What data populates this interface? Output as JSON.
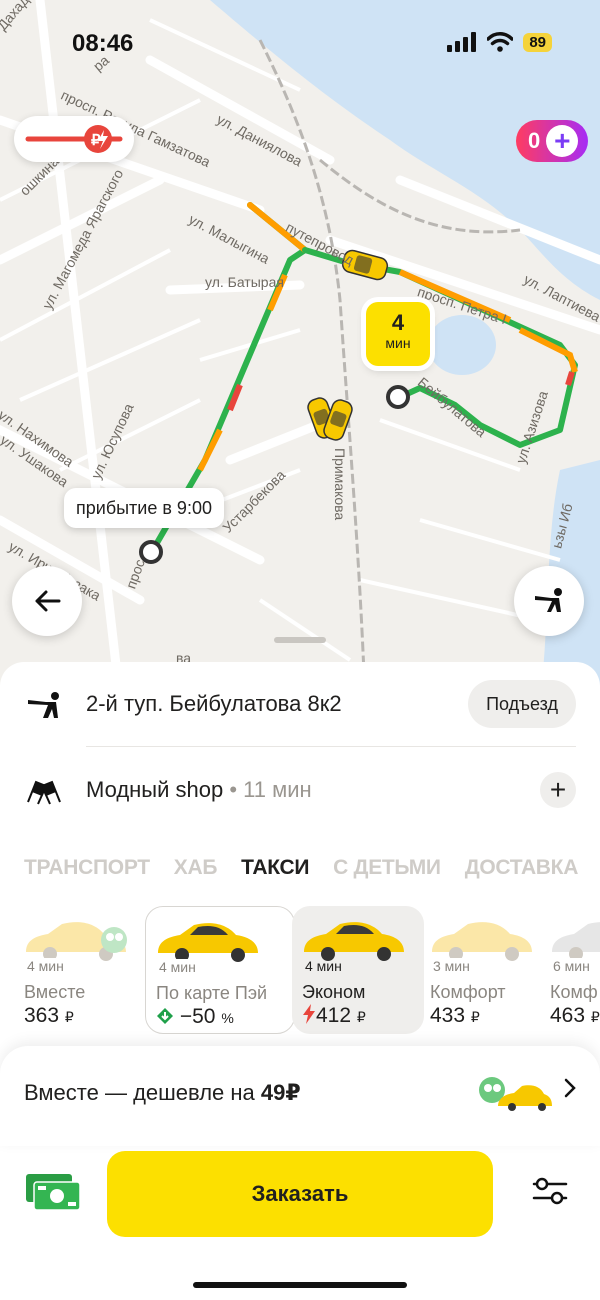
{
  "status_bar": {
    "time": "08:46",
    "battery": "89"
  },
  "map": {
    "streets": [
      "Дахадаев",
      "ра",
      "просп. Расула Гамзатова",
      "ул. Даниялова",
      "ошкина",
      "ул. Магомеда Ярагского",
      "ул. Малыгина",
      "путепровод",
      "ул. Батырая",
      "ул. Лаптиева",
      "просп. Петра I",
      "Бейбулатова",
      "ул. Азизова",
      "ул. Нахимова",
      "ул. Ушакова",
      "ул. Юсупова",
      "Устарбекова",
      "Примакова",
      "ул. Ирчи Казака",
      "прос",
      "ва",
      "ьзы Иб"
    ],
    "eta_bubble": {
      "value": "4",
      "unit": "мин"
    },
    "arrival_label": "прибытие в 9:00",
    "promo_count": "0"
  },
  "route": {
    "pickup": "2-й туп. Бейбулатова 8к2",
    "entrance_button": "Подъезд",
    "destination": "Модный shop",
    "destination_eta": "• 11 мин"
  },
  "categories": [
    "ТРАНСПОРТ",
    "ХАБ",
    "ТАКСИ",
    "С ДЕТЬМИ",
    "ДОСТАВКА"
  ],
  "active_category": "ТАКСИ",
  "tariffs": [
    {
      "eta": "4 мин",
      "name": "Вместе",
      "price": "363",
      "currency": "₽"
    },
    {
      "eta": "4 мин",
      "name": "По карте Пэй",
      "price": "−50",
      "currency": "%"
    },
    {
      "eta": "4 мин",
      "name": "Эконом",
      "price": "412",
      "currency": "₽"
    },
    {
      "eta": "3 мин",
      "name": "Комфорт",
      "price": "433",
      "currency": "₽"
    },
    {
      "eta": "6 мин",
      "name": "Комф",
      "price": "463",
      "currency": "₽"
    }
  ],
  "together_banner": {
    "text": "Вместе — дешевле на ",
    "amount": "49₽"
  },
  "order_button": "Заказать",
  "colors": {
    "accent_yellow": "#fce000",
    "traffic_green": "#2db24d",
    "traffic_orange": "#ff9d00",
    "traffic_red": "#e8453c",
    "discount_green": "#1fa04a"
  }
}
